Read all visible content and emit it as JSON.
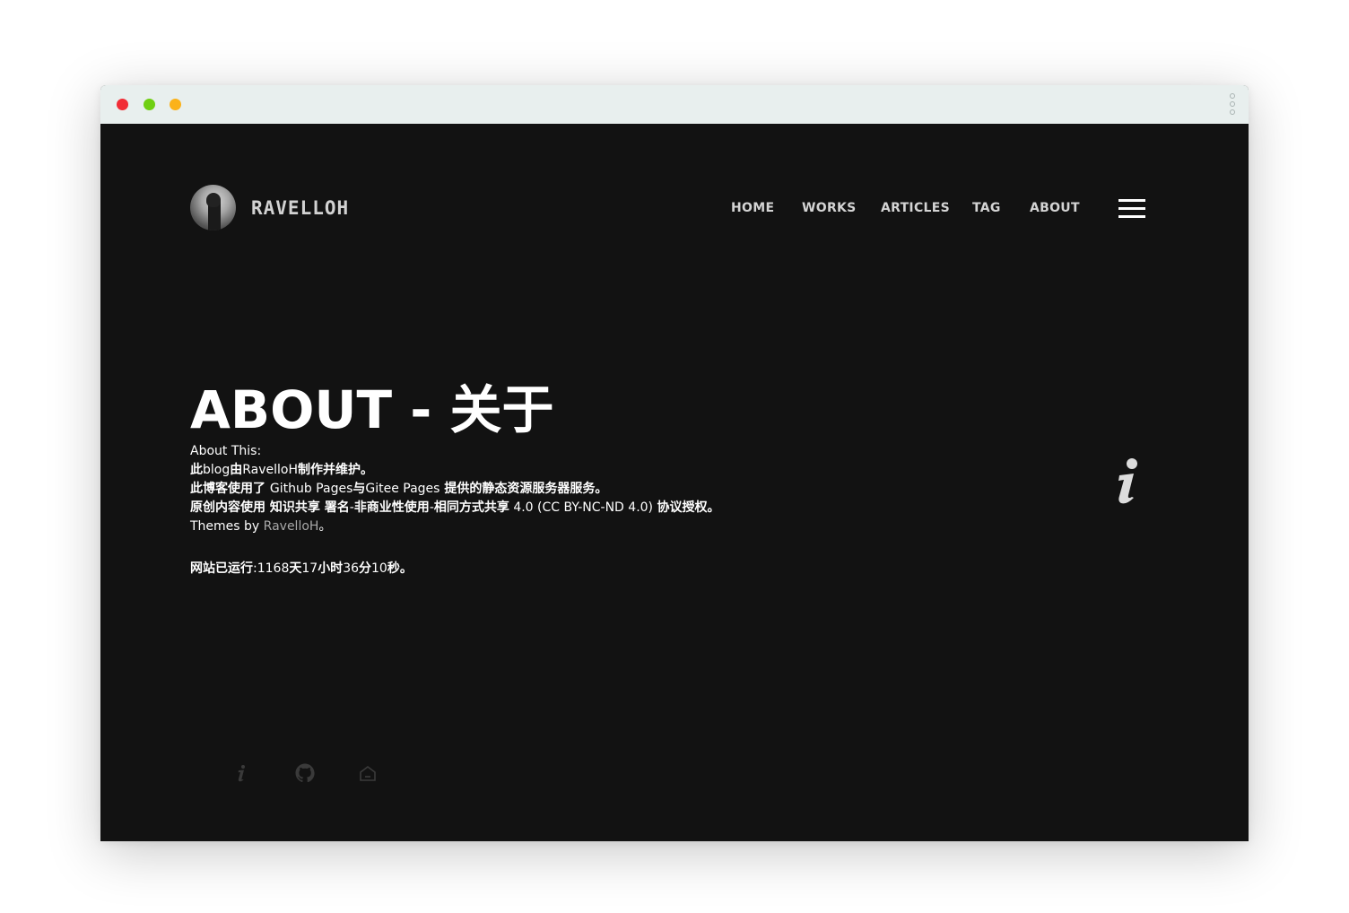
{
  "header": {
    "brand": "RAVELLOH",
    "nav": [
      {
        "label": "HOME"
      },
      {
        "label": "WORKS"
      },
      {
        "label": "ARTICLES"
      },
      {
        "label": "TAG"
      },
      {
        "label": "ABOUT"
      }
    ]
  },
  "main": {
    "title": "ABOUT - 关于",
    "about_label": "About This:",
    "line1": {
      "a": "此",
      "b": "blog",
      "c": "由",
      "d": "RavelloH",
      "e": "制作并维护。"
    },
    "line2": {
      "a": "此博客使用了 ",
      "b": "Github Pages",
      "c": "与",
      "d": "Gitee Pages",
      "e": " 提供的静态资源服务器服务。"
    },
    "line3": {
      "a": "原创内容使用 知识共享 署名",
      "b": "-",
      "c": "非商业性使用",
      "d": "-",
      "e": "相同方式共享",
      "f": " 4.0 (CC BY-NC-ND 4.0) ",
      "g": "协议授权。"
    },
    "line4": {
      "a": "Themes by ",
      "b": "RavelloH",
      "c": "。"
    },
    "uptime": {
      "a": "网站已运行",
      "b": ":1168",
      "c": "天",
      "d": "17",
      "e": "小时",
      "f": "36",
      "g": "分",
      "h": "10",
      "i": "秒。"
    }
  },
  "icons": {
    "side": "info-icon",
    "footer": [
      "info-icon",
      "github-icon",
      "home-icon"
    ]
  },
  "colors": {
    "page_bg": "#121212",
    "titlebar_bg": "#e8efee",
    "traffic_red": "#f12d36",
    "traffic_green": "#6fcf12",
    "traffic_yellow": "#fbb21a",
    "link_muted": "#a8a8a8"
  }
}
